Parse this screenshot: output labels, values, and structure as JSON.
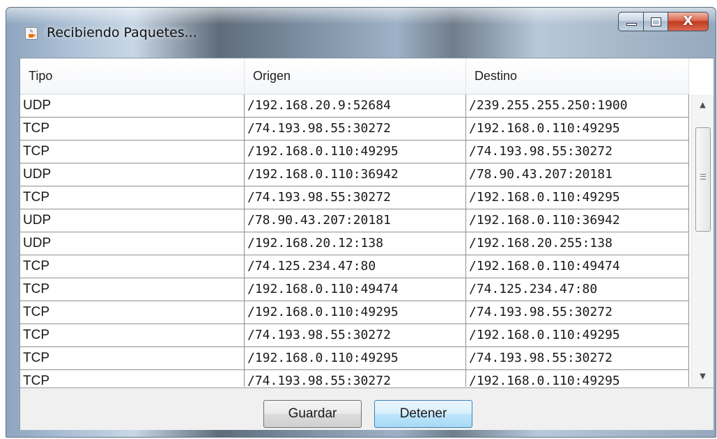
{
  "window": {
    "title": "Recibiendo Paquetes...",
    "close_glyph": "X",
    "app_icon": "java-cup-icon"
  },
  "table": {
    "columns": [
      "Tipo",
      "Origen",
      "Destino"
    ],
    "rows": [
      {
        "tipo": "UDP",
        "origen": "/192.168.20.9:52684",
        "destino": "/239.255.255.250:1900"
      },
      {
        "tipo": "TCP",
        "origen": "/74.193.98.55:30272",
        "destino": "/192.168.0.110:49295"
      },
      {
        "tipo": "TCP",
        "origen": "/192.168.0.110:49295",
        "destino": "/74.193.98.55:30272"
      },
      {
        "tipo": "UDP",
        "origen": "/192.168.0.110:36942",
        "destino": "/78.90.43.207:20181"
      },
      {
        "tipo": "TCP",
        "origen": "/74.193.98.55:30272",
        "destino": "/192.168.0.110:49295"
      },
      {
        "tipo": "UDP",
        "origen": "/78.90.43.207:20181",
        "destino": "/192.168.0.110:36942"
      },
      {
        "tipo": "UDP",
        "origen": "/192.168.20.12:138",
        "destino": "/192.168.20.255:138"
      },
      {
        "tipo": "TCP",
        "origen": "/74.125.234.47:80",
        "destino": "/192.168.0.110:49474"
      },
      {
        "tipo": "TCP",
        "origen": "/192.168.0.110:49474",
        "destino": "/74.125.234.47:80"
      },
      {
        "tipo": "TCP",
        "origen": "/192.168.0.110:49295",
        "destino": "/74.193.98.55:30272"
      },
      {
        "tipo": "TCP",
        "origen": "/74.193.98.55:30272",
        "destino": "/192.168.0.110:49295"
      },
      {
        "tipo": "TCP",
        "origen": "/192.168.0.110:49295",
        "destino": "/74.193.98.55:30272"
      },
      {
        "tipo": "TCP",
        "origen": "/74.193.98.55:30272",
        "destino": "/192.168.0.110:49295"
      }
    ]
  },
  "buttons": {
    "guardar": "Guardar",
    "detener": "Detener"
  },
  "scrollbar": {
    "up_glyph": "▲",
    "down_glyph": "▼"
  },
  "colors": {
    "grid_line": "#8f8f8f",
    "focused_button": "#bee6fd",
    "close_button": "#c0391f"
  }
}
